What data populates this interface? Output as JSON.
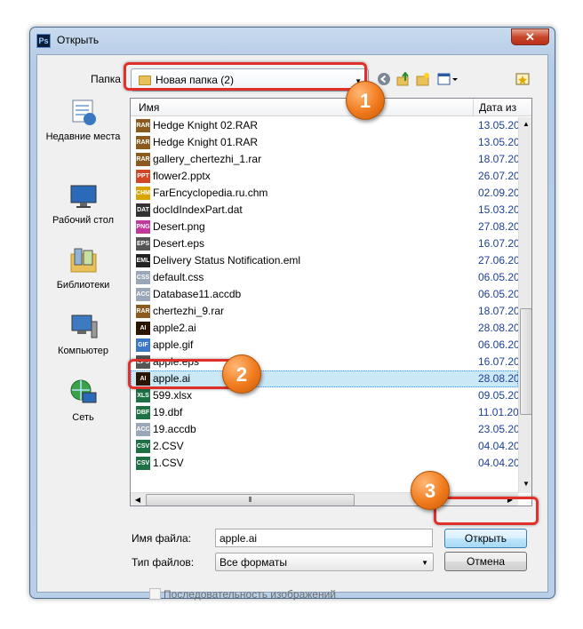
{
  "window": {
    "title": "Открыть",
    "app_icon": "Ps",
    "close_glyph": "✕"
  },
  "look_in": {
    "label": "Папка",
    "value": "Новая папка (2)"
  },
  "toolbar": {
    "icons": [
      "back-icon",
      "up-folder-icon",
      "new-folder-icon",
      "view-menu-icon"
    ]
  },
  "places": [
    {
      "label": "Недавние места",
      "icon": "recent-places-icon"
    },
    {
      "label": "Рабочий стол",
      "icon": "desktop-icon"
    },
    {
      "label": "Библиотеки",
      "icon": "libraries-icon"
    },
    {
      "label": "Компьютер",
      "icon": "computer-icon"
    },
    {
      "label": "Сеть",
      "icon": "network-icon"
    }
  ],
  "columns": {
    "name": "Имя",
    "date": "Дата из"
  },
  "files": [
    {
      "name": "Hedge Knight 02.RAR",
      "date": "13.05.20",
      "type": "rar",
      "color": "#8a5a1e"
    },
    {
      "name": "Hedge Knight 01.RAR",
      "date": "13.05.20",
      "type": "rar",
      "color": "#8a5a1e"
    },
    {
      "name": "gallery_chertezhi_1.rar",
      "date": "18.07.20",
      "type": "rar",
      "color": "#8a5a1e"
    },
    {
      "name": "flower2.pptx",
      "date": "26.07.20",
      "type": "pptx",
      "color": "#d24726"
    },
    {
      "name": "FarEncyclopedia.ru.chm",
      "date": "02.09.20",
      "type": "chm",
      "color": "#d9a400"
    },
    {
      "name": "docIdIndexPart.dat",
      "date": "15.03.20",
      "type": "dat",
      "color": "#333333"
    },
    {
      "name": "Desert.png",
      "date": "27.08.20",
      "type": "png",
      "color": "#c0399b"
    },
    {
      "name": "Desert.eps",
      "date": "16.07.20",
      "type": "eps",
      "color": "#555555"
    },
    {
      "name": "Delivery Status Notification.eml",
      "date": "27.06.20",
      "type": "eml",
      "color": "#222222"
    },
    {
      "name": "default.css",
      "date": "06.05.20",
      "type": "css",
      "color": "#9aa7b8"
    },
    {
      "name": "Database11.accdb",
      "date": "06.05.20",
      "type": "accdb",
      "color": "#9aa7b8"
    },
    {
      "name": "chertezhi_9.rar",
      "date": "18.07.20",
      "type": "rar",
      "color": "#8a5a1e"
    },
    {
      "name": "apple2.ai",
      "date": "28.08.20",
      "type": "ai",
      "color": "#2b1400"
    },
    {
      "name": "apple.gif",
      "date": "06.06.20",
      "type": "gif",
      "color": "#3c78c8"
    },
    {
      "name": "apple.eps",
      "date": "16.07.20",
      "type": "eps",
      "color": "#555555"
    },
    {
      "name": "apple.ai",
      "date": "28.08.20",
      "type": "ai",
      "color": "#2b1400",
      "selected": true
    },
    {
      "name": "599.xlsx",
      "date": "09.05.20",
      "type": "xlsx",
      "color": "#1e7145"
    },
    {
      "name": "19.dbf",
      "date": "11.01.20",
      "type": "dbf",
      "color": "#1e7145"
    },
    {
      "name": "19.accdb",
      "date": "23.05.20",
      "type": "accdb",
      "color": "#9aa7b8"
    },
    {
      "name": "2.CSV",
      "date": "04.04.20",
      "type": "csv",
      "color": "#1e7145"
    },
    {
      "name": "1.CSV",
      "date": "04.04.20",
      "type": "csv",
      "color": "#1e7145"
    }
  ],
  "file_name": {
    "label": "Имя файла:",
    "value": "apple.ai"
  },
  "file_type": {
    "label": "Тип файлов:",
    "value": "Все форматы"
  },
  "buttons": {
    "open": "Открыть",
    "cancel": "Отмена"
  },
  "image_sequence": {
    "label": "Последовательность изображений",
    "checked": false
  },
  "callouts": [
    "1",
    "2",
    "3"
  ],
  "accent_color": "#e0302a",
  "badge_color": "#f07a1c"
}
